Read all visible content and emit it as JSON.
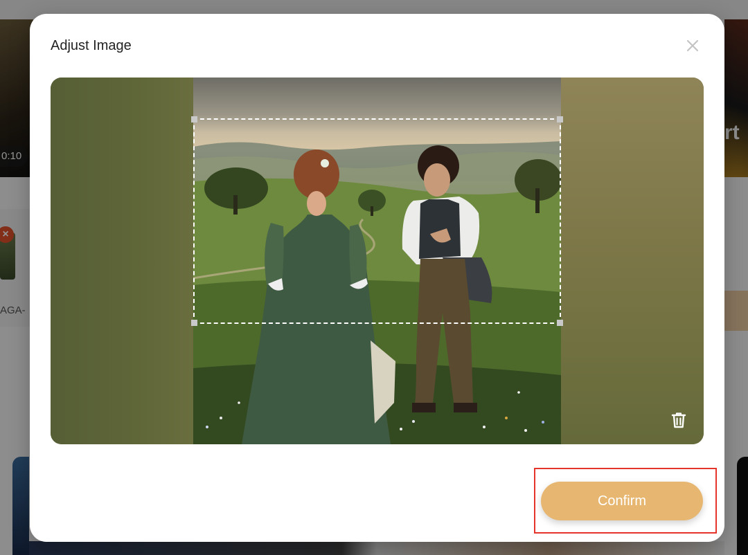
{
  "background": {
    "video_time": "0:10",
    "right_fragment": "rt",
    "remove_icon": "×",
    "clip_label": "AGA-"
  },
  "modal": {
    "title": "Adjust Image",
    "close_icon": "close-icon",
    "delete_icon": "trash-icon",
    "confirm_label": "Confirm"
  },
  "colors": {
    "accent": "#e7b772",
    "highlight": "#e5352a",
    "crop_border": "#ffffff"
  }
}
